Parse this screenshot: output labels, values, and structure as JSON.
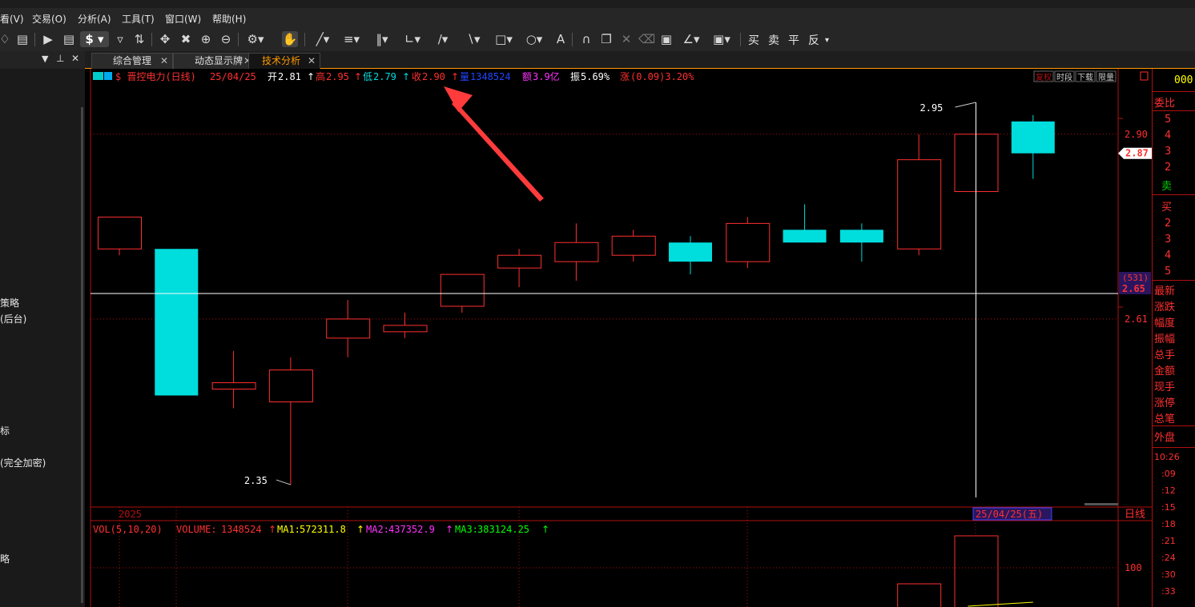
{
  "menu": {
    "items": [
      "看(V)",
      "交易(O)",
      "分析(A)",
      "工具(T)",
      "窗口(W)",
      "帮助(H)"
    ]
  },
  "toolbar": {
    "trade_buttons": [
      "买",
      "卖",
      "平",
      "反"
    ],
    "icons": [
      "bell-icon",
      "chart-icon",
      "play-icon",
      "document-icon",
      "dollar-icon",
      "filter-icon",
      "sort-icon",
      "move-icon",
      "cross-icon",
      "zoom-in-icon",
      "zoom-out-icon",
      "gear-icon",
      "hand-icon",
      "line-icon",
      "fib-icon",
      "cycle-icon",
      "fan-icon",
      "channel-icon",
      "parallel-icon",
      "rect-icon",
      "circle-icon",
      "text-icon",
      "magnet-icon",
      "copy-icon",
      "delete-icon",
      "trash-icon",
      "lock-icon",
      "pen-icon",
      "save-icon"
    ]
  },
  "left_panel": {
    "items": [
      "策略",
      "(后台)",
      "标",
      "(完全加密)",
      "略"
    ]
  },
  "tabs": [
    {
      "label": "综合管理"
    },
    {
      "label": "动态显示牌"
    },
    {
      "label": "技术分析"
    }
  ],
  "info_bar": {
    "symbol": "$ 晋控电力(日线)",
    "date": "25/04/25",
    "open_label": "开",
    "open": "2.81",
    "high_label": "高",
    "high": "2.95",
    "low_label": "低",
    "low": "2.79",
    "close_label": "收",
    "close": "2.90",
    "volume_label": "量",
    "volume": "1348524",
    "amount_label": "额",
    "amount": "3.9亿",
    "amplitude_label": "振",
    "amplitude": "5.69%",
    "change_label": "涨",
    "change": "(0.09)3.20%"
  },
  "chart_buttons": [
    "复权",
    "时段",
    "下载",
    "限量"
  ],
  "chart_data": {
    "type": "candlestick",
    "ylim": [
      2.33,
      2.96
    ],
    "y_ticks": [
      2.9,
      2.61
    ],
    "y_tick_labels": [
      "2.90",
      "2.61"
    ],
    "candles": [
      {
        "open": 2.77,
        "close": 2.72,
        "high": 2.77,
        "low": 2.71,
        "color": "red"
      },
      {
        "open": 2.72,
        "close": 2.49,
        "high": 2.72,
        "low": 2.49,
        "color": "cyan"
      },
      {
        "open": 2.5,
        "close": 2.51,
        "high": 2.56,
        "low": 2.47,
        "color": "red"
      },
      {
        "open": 2.48,
        "close": 2.53,
        "high": 2.55,
        "low": 2.35,
        "color": "red"
      },
      {
        "open": 2.58,
        "close": 2.61,
        "high": 2.64,
        "low": 2.55,
        "color": "red"
      },
      {
        "open": 2.59,
        "close": 2.6,
        "high": 2.62,
        "low": 2.58,
        "color": "red"
      },
      {
        "open": 2.63,
        "close": 2.68,
        "high": 2.68,
        "low": 2.62,
        "color": "red"
      },
      {
        "open": 2.69,
        "close": 2.71,
        "high": 2.72,
        "low": 2.66,
        "color": "red"
      },
      {
        "open": 2.7,
        "close": 2.73,
        "high": 2.76,
        "low": 2.67,
        "color": "red"
      },
      {
        "open": 2.71,
        "close": 2.74,
        "high": 2.75,
        "low": 2.7,
        "color": "red"
      },
      {
        "open": 2.73,
        "close": 2.7,
        "high": 2.74,
        "low": 2.68,
        "color": "cyan"
      },
      {
        "open": 2.7,
        "close": 2.76,
        "high": 2.77,
        "low": 2.69,
        "color": "red"
      },
      {
        "open": 2.75,
        "close": 2.73,
        "high": 2.79,
        "low": 2.73,
        "color": "cyan"
      },
      {
        "open": 2.75,
        "close": 2.73,
        "high": 2.76,
        "low": 2.7,
        "color": "cyan"
      },
      {
        "open": 2.72,
        "close": 2.86,
        "high": 2.9,
        "low": 2.71,
        "color": "red"
      },
      {
        "open": 2.81,
        "close": 2.9,
        "high": 2.95,
        "low": 2.79,
        "color": "red"
      },
      {
        "open": 2.92,
        "close": 2.87,
        "high": 2.93,
        "low": 2.83,
        "color": "cyan"
      }
    ],
    "annotations": {
      "high_label": "2.95",
      "low_label": "2.35"
    },
    "reference_line": {
      "value": 2.65,
      "label": "2.65",
      "tag": "(531)"
    },
    "price_marker": "2.87",
    "x_axis_label": "2025",
    "cursor_date": "25/04/25(五)",
    "period_label": "日线",
    "volume_panel": {
      "header": "VOL(5,10,20)",
      "volume_label": "VOLUME:",
      "volume": "1348524",
      "ma1_label": "MA1:",
      "ma1": "572311.8",
      "ma2_label": "MA2:",
      "ma2": "437352.9",
      "ma3_label": "MA3:",
      "ma3": "383124.25",
      "y_tick_label": "100"
    }
  },
  "right_panel": {
    "top_value": "000",
    "weibi": "委比",
    "sell_levels": [
      "5",
      "4",
      "3",
      "2"
    ],
    "sell_label": "卖",
    "buy_label": "买",
    "buy_levels": [
      "2",
      "3",
      "4",
      "5"
    ],
    "quote_labels": [
      "最新",
      "涨跌",
      "幅度",
      "振幅",
      "总手",
      "金额",
      "现手",
      "涨停",
      "总笔"
    ],
    "outer_label": "外盘",
    "times": [
      "10:26",
      ":09",
      ":12",
      ":15",
      ":18",
      ":21",
      ":24",
      ":30",
      ":33"
    ]
  },
  "colors": {
    "up": "#ff3030",
    "down": "#00dddd",
    "background": "#000000",
    "accent": "#ff9900",
    "ma1": "#ffff00",
    "ma2": "#ff00ff",
    "ma3": "#00ff00",
    "arrow": "#ff3b3b"
  }
}
